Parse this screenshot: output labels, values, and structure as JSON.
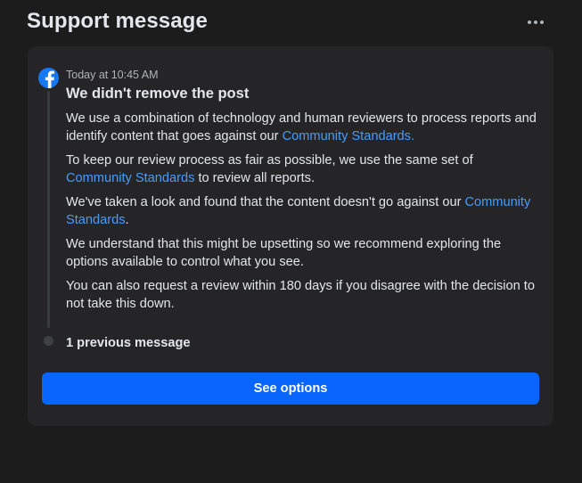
{
  "header": {
    "title": "Support message",
    "more_icon": "more-horizontal-icon"
  },
  "message": {
    "source_icon": "facebook-logo-icon",
    "timestamp": "Today at 10:45 AM",
    "title": "We didn't remove the post",
    "paragraphs": [
      {
        "before": "We use a combination of technology and human reviewers to process reports and identify content that goes against our ",
        "link": "Community Standards.",
        "after": ""
      },
      {
        "before": "To keep our review process as fair as possible, we use the same set of ",
        "link": "Community Standards",
        "after": " to review all reports."
      },
      {
        "before": "We've taken a look and found that the content doesn't go against our ",
        "link": "Community Standards",
        "after": "."
      },
      {
        "before": "We understand that this might be upsetting so we recommend exploring the options available to control what you see.",
        "link": "",
        "after": ""
      },
      {
        "before": "You can also request a review within 180 days if you disagree with the decision to not take this down.",
        "link": "",
        "after": ""
      }
    ]
  },
  "previous_messages_label": "1 previous message",
  "primary_button_label": "See options",
  "colors": {
    "background": "#1c1c1d",
    "card": "#252527",
    "link": "#4a9cf9",
    "primary_button": "#0866ff",
    "facebook_brand": "#1877f2"
  }
}
